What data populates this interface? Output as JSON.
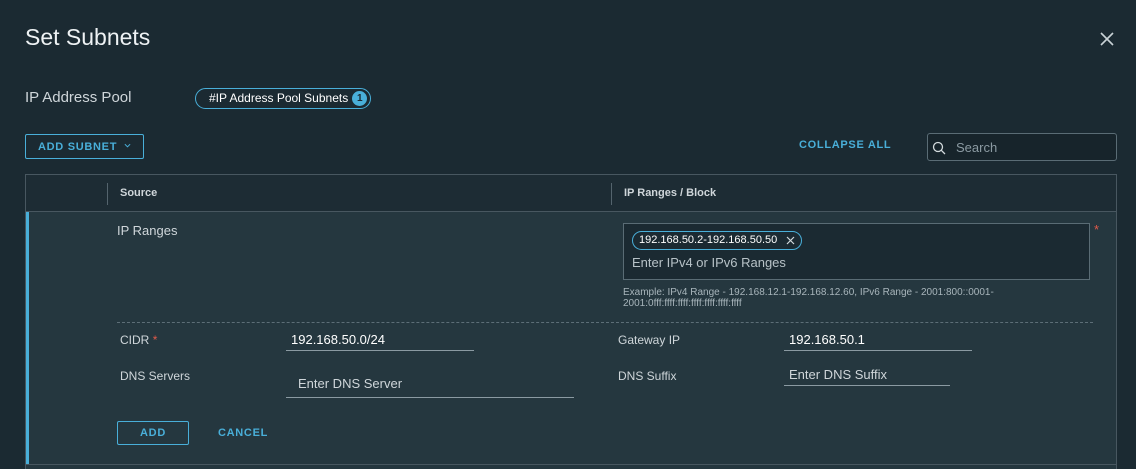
{
  "dialog": {
    "title": "Set Subnets"
  },
  "pool": {
    "label": "IP Address Pool",
    "chip_label": "#IP Address Pool Subnets",
    "chip_count": "1"
  },
  "toolbar": {
    "add_subnet_label": "ADD SUBNET",
    "collapse_all_label": "COLLAPSE ALL",
    "search_placeholder": "Search",
    "search_value": ""
  },
  "grid": {
    "columns": [
      "Source",
      "IP Ranges / Block"
    ]
  },
  "form": {
    "ip_ranges_label": "IP Ranges",
    "ip_ranges_chip": "192.168.50.2-192.168.50.50",
    "ip_ranges_placeholder": "Enter IPv4 or IPv6 Ranges",
    "ip_ranges_example": "Example: IPv4 Range - 192.168.12.1-192.168.12.60, IPv6 Range - 2001:800::0001-2001:0fff:ffff:ffff:ffff:ffff:ffff:ffff",
    "required_mark": "*",
    "cidr_label": "CIDR",
    "cidr_value": "192.168.50.0/24",
    "gateway_label": "Gateway IP",
    "gateway_value": "192.168.50.1",
    "dns_servers_label": "DNS Servers",
    "dns_servers_placeholder": "Enter DNS Server",
    "dns_suffix_label": "DNS Suffix",
    "dns_suffix_placeholder": "Enter DNS Suffix",
    "add_label": "ADD",
    "cancel_label": "CANCEL"
  },
  "icons": {
    "close": "close-icon",
    "search": "search-icon",
    "chevron": "chevron-down-icon",
    "chip_remove": "close-icon"
  },
  "colors": {
    "accent": "#49afd9",
    "background": "#1b2a32",
    "row_background": "#25373f",
    "required": "#e05a4a"
  }
}
